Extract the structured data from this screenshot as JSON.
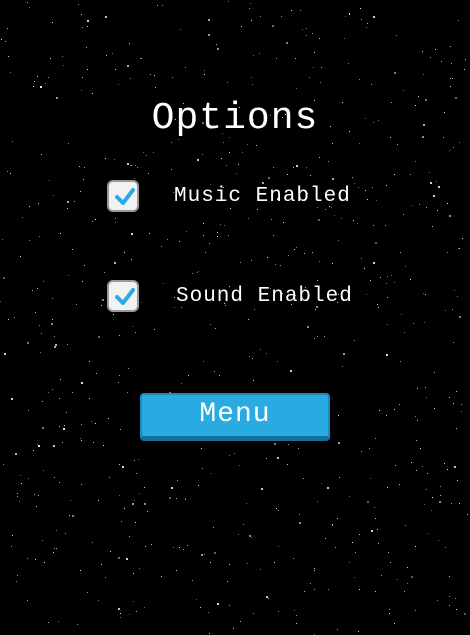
{
  "screen": {
    "title": "Options",
    "background_color": "#000000"
  },
  "options": [
    {
      "label": "Music Enabled",
      "checked": true
    },
    {
      "label": "Sound Enabled",
      "checked": true
    }
  ],
  "menu_button": {
    "label": "Menu",
    "color": "#29abe2"
  },
  "icons": {
    "checkbox_check": "checkmark-icon"
  }
}
